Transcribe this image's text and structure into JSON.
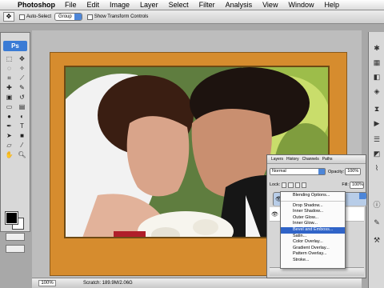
{
  "menubar": {
    "app_name": "Photoshop",
    "items": [
      "File",
      "Edit",
      "Image",
      "Layer",
      "Select",
      "Filter",
      "Analysis",
      "View",
      "Window",
      "Help"
    ]
  },
  "options_bar": {
    "auto_select_label": "Auto-Select",
    "auto_select_value": "Group",
    "transform_label": "Show Transform Controls"
  },
  "toolbox": {
    "logo": "Ps",
    "tool_icons": [
      "marquee-icon",
      "move-icon",
      "lasso-icon",
      "magic-wand-icon",
      "crop-icon",
      "slice-icon",
      "healing-icon",
      "brush-icon",
      "stamp-icon",
      "history-brush-icon",
      "eraser-icon",
      "gradient-icon",
      "blur-icon",
      "dodge-icon",
      "pen-icon",
      "type-icon",
      "path-select-icon",
      "shape-icon",
      "notes-icon",
      "eyedropper-icon",
      "hand-icon",
      "zoom-icon"
    ],
    "foreground_color": "#000000",
    "background_color": "#ffffff"
  },
  "document": {
    "zoom": "100%",
    "scratch": "Scratch: 189.9M/2.06G",
    "frame_color": "#d68c2e"
  },
  "layers_palette": {
    "tabs": [
      "Layers",
      "History",
      "Channels",
      "Paths"
    ],
    "blend_mode": "Normal",
    "opacity_label": "Opacity:",
    "opacity_value": "100%",
    "lock_label": "Lock:",
    "fill_label": "Fill:",
    "fill_value": "100%"
  },
  "context_menu": {
    "items_top": [
      "Blending Options..."
    ],
    "items": [
      "Drop Shadow...",
      "Inner Shadow...",
      "Outer Glow...",
      "Inner Glow...",
      "Bevel and Emboss...",
      "Satin...",
      "Color Overlay...",
      "Gradient Overlay...",
      "Pattern Overlay...",
      "Stroke..."
    ],
    "highlighted": "Bevel and Emboss..."
  }
}
